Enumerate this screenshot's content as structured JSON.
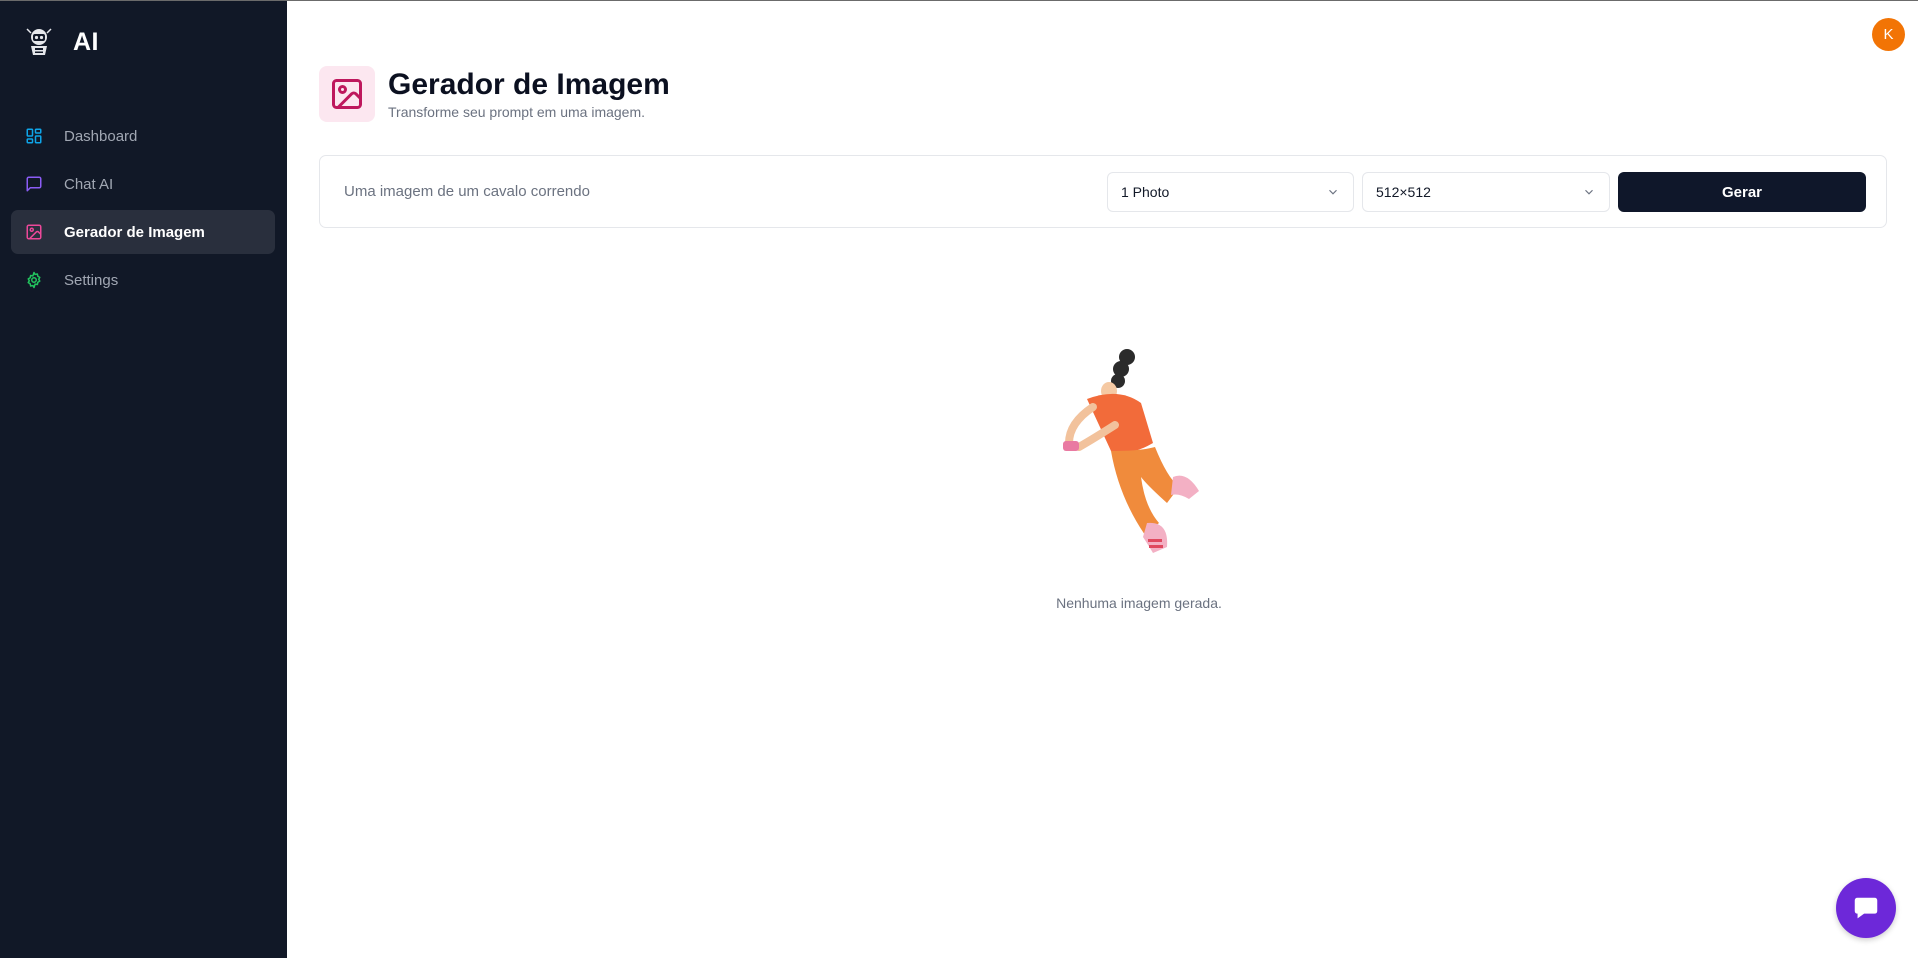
{
  "app": {
    "name": "AI"
  },
  "sidebar": {
    "items": [
      {
        "label": "Dashboard",
        "icon": "layout-dashboard-icon",
        "color": "#0ea5e9",
        "active": false
      },
      {
        "label": "Chat AI",
        "icon": "message-square-icon",
        "color": "#8b5cf6",
        "active": false
      },
      {
        "label": "Gerador de Imagem",
        "icon": "image-icon",
        "color": "#ec4899",
        "active": true
      },
      {
        "label": "Settings",
        "icon": "settings-icon",
        "color": "#22c55e",
        "active": false
      }
    ]
  },
  "user": {
    "avatar_initial": "K",
    "avatar_color": "#f27405"
  },
  "header": {
    "title": "Gerador de Imagem",
    "subtitle": "Transforme seu prompt em uma imagem.",
    "icon": "image-icon",
    "icon_color": "#be185d"
  },
  "form": {
    "prompt_placeholder": "Uma imagem de um cavalo correndo",
    "prompt_value": "",
    "amount_selected": "1 Photo",
    "resolution_selected": "512×512",
    "submit_label": "Gerar"
  },
  "empty_state": {
    "text": "Nenhuma imagem gerada."
  },
  "chat_widget": {
    "icon": "chat-bubble-icon",
    "color": "#6d28d9"
  }
}
